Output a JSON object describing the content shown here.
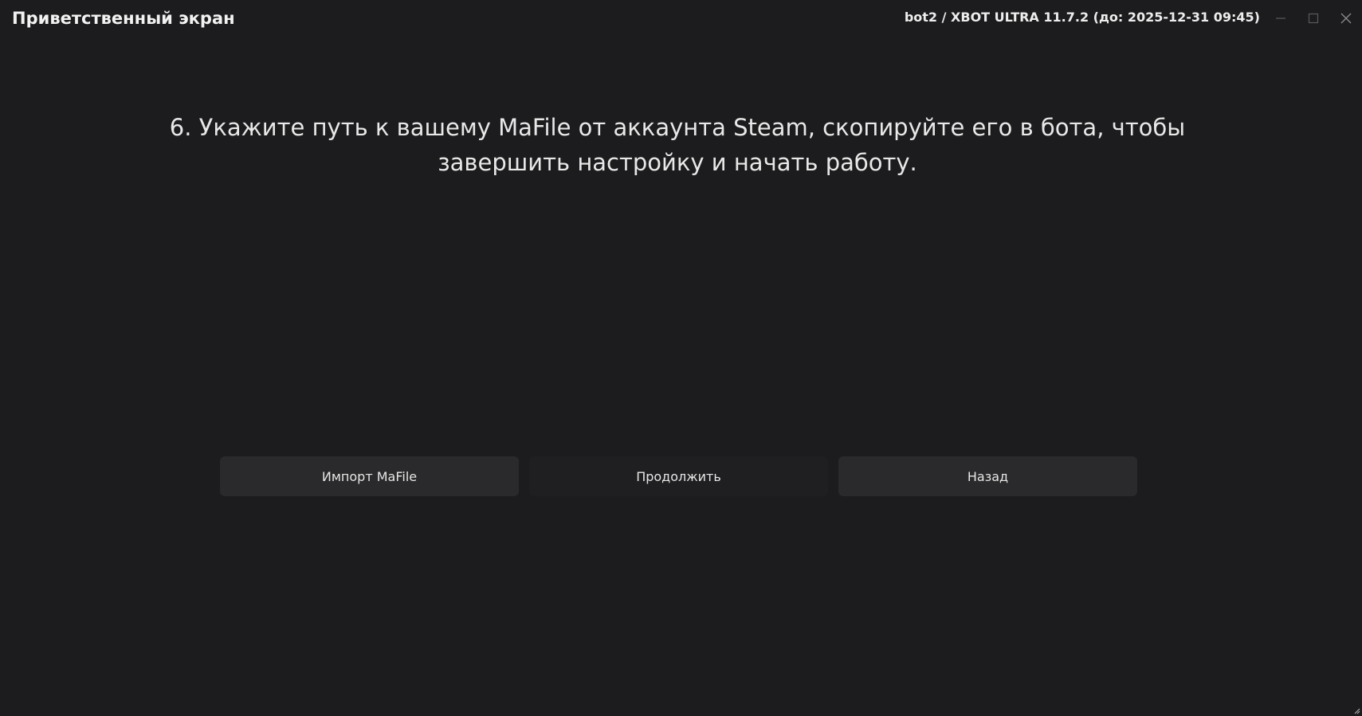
{
  "window": {
    "title": "Приветственный экран",
    "bot_info": "bot2 / XBOT ULTRA 11.7.2 (до: 2025-12-31 09:45)",
    "controls": {
      "minimize_icon": "minimize-icon",
      "maximize_icon": "maximize-icon",
      "close_icon": "close-icon"
    }
  },
  "main": {
    "instruction": "6. Укажите путь к вашему MaFile от аккаунта Steam, скопируйте его в бота, чтобы завершить настройку и начать работу."
  },
  "actions": {
    "import_label": "Импорт MaFile",
    "continue_label": "Продолжить",
    "back_label": "Назад"
  },
  "colors": {
    "background": "#1c1c1e",
    "button": "#2a2a2c",
    "text": "#e6e6e6"
  }
}
